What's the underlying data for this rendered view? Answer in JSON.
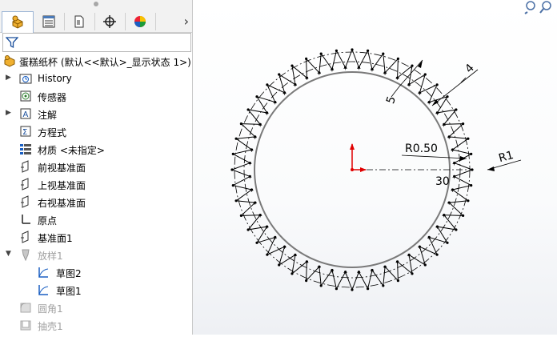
{
  "panel": {
    "tabs": [
      {
        "name": "feature-manager-tab"
      },
      {
        "name": "property-manager-tab"
      },
      {
        "name": "configuration-manager-tab"
      },
      {
        "name": "dimxpert-tab"
      },
      {
        "name": "display-manager-tab"
      }
    ],
    "more_arrow": "›"
  },
  "tree": {
    "root": "蛋糕纸杯 (默认<<默认>_显示状态 1>)",
    "items": [
      {
        "label": "History",
        "expand": "▶",
        "icon": "history-folder-icon"
      },
      {
        "label": "传感器",
        "expand": "",
        "icon": "sensor-icon"
      },
      {
        "label": "注解",
        "expand": "▶",
        "icon": "annotation-icon"
      },
      {
        "label": "方程式",
        "expand": "",
        "icon": "equation-icon"
      },
      {
        "label": "材质 <未指定>",
        "expand": "",
        "icon": "material-icon"
      },
      {
        "label": "前视基准面",
        "expand": "",
        "icon": "plane-icon"
      },
      {
        "label": "上视基准面",
        "expand": "",
        "icon": "plane-icon"
      },
      {
        "label": "右视基准面",
        "expand": "",
        "icon": "plane-icon"
      },
      {
        "label": "原点",
        "expand": "",
        "icon": "origin-icon"
      },
      {
        "label": "基准面1",
        "expand": "",
        "icon": "plane-icon"
      },
      {
        "label": "放样1",
        "expand": "▼",
        "icon": "loft-icon",
        "dim": true
      },
      {
        "label": "草图2",
        "expand": "",
        "icon": "sketch-icon",
        "indent": true
      },
      {
        "label": "草图1",
        "expand": "",
        "icon": "sketch-icon",
        "indent": true
      },
      {
        "label": "圆角1",
        "expand": "",
        "icon": "fillet-icon",
        "dim": true
      },
      {
        "label": "抽壳1",
        "expand": "",
        "icon": "shell-icon",
        "dim": true
      }
    ]
  },
  "sketch": {
    "dimensions": {
      "d_top": "4",
      "d_left": "5",
      "d_radius_small": "R0.50",
      "d_radius_outer": "R1",
      "d_diameter": "30"
    },
    "colors": {
      "line": "#000000",
      "inner_circle": "#7a7a7a",
      "origin": "#e00000",
      "dimension": "#000000"
    },
    "zigzag_teeth": 48
  }
}
